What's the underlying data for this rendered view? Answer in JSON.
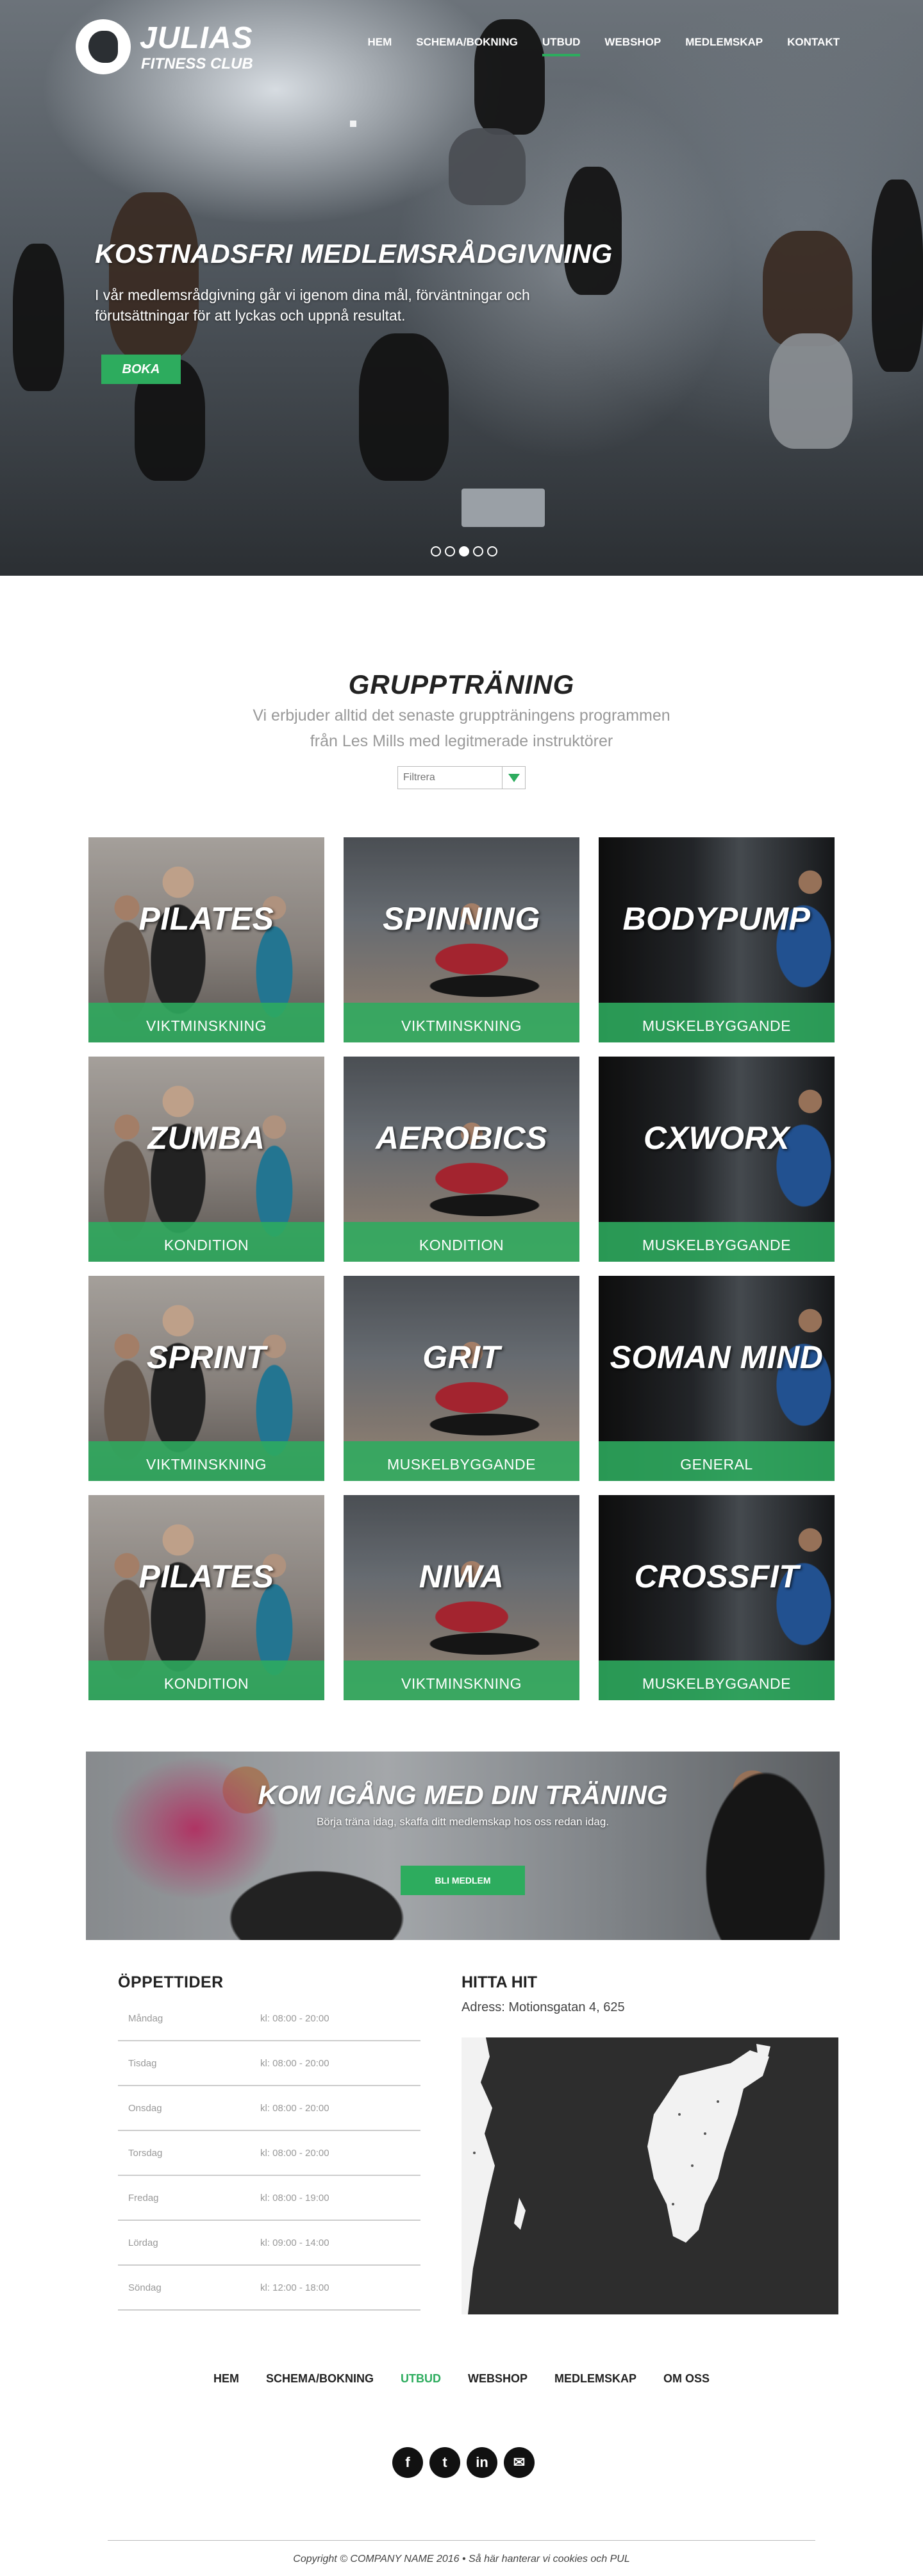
{
  "brand": {
    "title": "JULIAS",
    "subtitle": "FITNESS CLUB"
  },
  "nav": {
    "items": [
      {
        "label": "HEM",
        "active": false
      },
      {
        "label": "SCHEMA/BOKNING",
        "active": false
      },
      {
        "label": "UTBUD",
        "active": true
      },
      {
        "label": "WEBSHOP",
        "active": false
      },
      {
        "label": "MEDLEMSKAP",
        "active": false
      },
      {
        "label": "KONTAKT",
        "active": false
      }
    ]
  },
  "hero": {
    "title": "KOSTNADSFRI MEDLEMSRÅDGIVNING",
    "text": " I vår medlemsrådgivning går vi igenom dina mål, förväntningar och förutsättningar för att lyckas och uppnå resultat.",
    "button": "BOKA",
    "slides_total": 5,
    "slide_active": 3
  },
  "group": {
    "title": "GRUPPTRÄNING",
    "subtitle": "Vi erbjuder alltid det senaste gruppträningens programmen från Les Mills med legitmerade instruktörer",
    "filter_placeholder": "Filtrera",
    "cards": [
      {
        "name": "PILATES",
        "tag": "VIKTMINSKNING",
        "photo": "p1"
      },
      {
        "name": "SPINNING",
        "tag": "VIKTMINSKNING",
        "photo": "p2"
      },
      {
        "name": "BODYPUMP",
        "tag": "MUSKELBYGGANDE",
        "photo": "p3"
      },
      {
        "name": "ZUMBA",
        "tag": "KONDITION",
        "photo": "p1"
      },
      {
        "name": "AEROBICS",
        "tag": "KONDITION",
        "photo": "p2"
      },
      {
        "name": "CXWORX",
        "tag": "MUSKELBYGGANDE",
        "photo": "p3"
      },
      {
        "name": "SPRINT",
        "tag": "VIKTMINSKNING",
        "photo": "p1"
      },
      {
        "name": "GRIT",
        "tag": "MUSKELBYGGANDE",
        "photo": "p2"
      },
      {
        "name": "SOMAN MIND",
        "tag": "GENERAL",
        "photo": "p3"
      },
      {
        "name": "PILATES",
        "tag": "KONDITION",
        "photo": "p1"
      },
      {
        "name": "NIWA",
        "tag": "VIKTMINSKNING",
        "photo": "p2"
      },
      {
        "name": "CROSSFIT",
        "tag": "MUSKELBYGGANDE",
        "photo": "p3"
      }
    ]
  },
  "cta": {
    "title": "KOM IGÅNG MED DIN TRÄNING",
    "subtitle": "Börja träna idag, skaffa ditt medlemskap hos oss redan idag.",
    "button": "BLI MEDLEM"
  },
  "hours": {
    "title": "ÖPPETTIDER",
    "rows": [
      {
        "day": "Måndag",
        "time": "kl: 08:00 - 20:00"
      },
      {
        "day": "Tisdag",
        "time": "kl: 08:00 - 20:00"
      },
      {
        "day": "Onsdag",
        "time": "kl: 08:00 - 20:00"
      },
      {
        "day": "Torsdag",
        "time": "kl: 08:00 - 20:00"
      },
      {
        "day": "Fredag",
        "time": "kl: 08:00 - 19:00"
      },
      {
        "day": "Lördag",
        "time": "kl: 09:00 - 14:00"
      },
      {
        "day": "Söndag",
        "time": "kl: 12:00 - 18:00"
      }
    ]
  },
  "find": {
    "title": "HITTA HIT",
    "address": "Adress: Motionsgatan 4, 625"
  },
  "footer": {
    "nav": [
      {
        "label": "HEM",
        "active": false
      },
      {
        "label": "SCHEMA/BOKNING",
        "active": false
      },
      {
        "label": "UTBUD",
        "active": true
      },
      {
        "label": "WEBSHOP",
        "active": false
      },
      {
        "label": "MEDLEMSKAP",
        "active": false
      },
      {
        "label": "OM OSS",
        "active": false
      }
    ],
    "socials": [
      {
        "icon": "facebook-icon",
        "glyph": "f"
      },
      {
        "icon": "twitter-icon",
        "glyph": "t"
      },
      {
        "icon": "linkedin-icon",
        "glyph": "in"
      },
      {
        "icon": "mail-icon",
        "glyph": "✉"
      }
    ],
    "copyright": "Copyright © COMPANY NAME 2016 • Så här hanterar vi cookies och PUL"
  },
  "colors": {
    "accent": "#2dac5e",
    "map_bg": "#2d2d2d",
    "land": "#f2f2f2"
  }
}
